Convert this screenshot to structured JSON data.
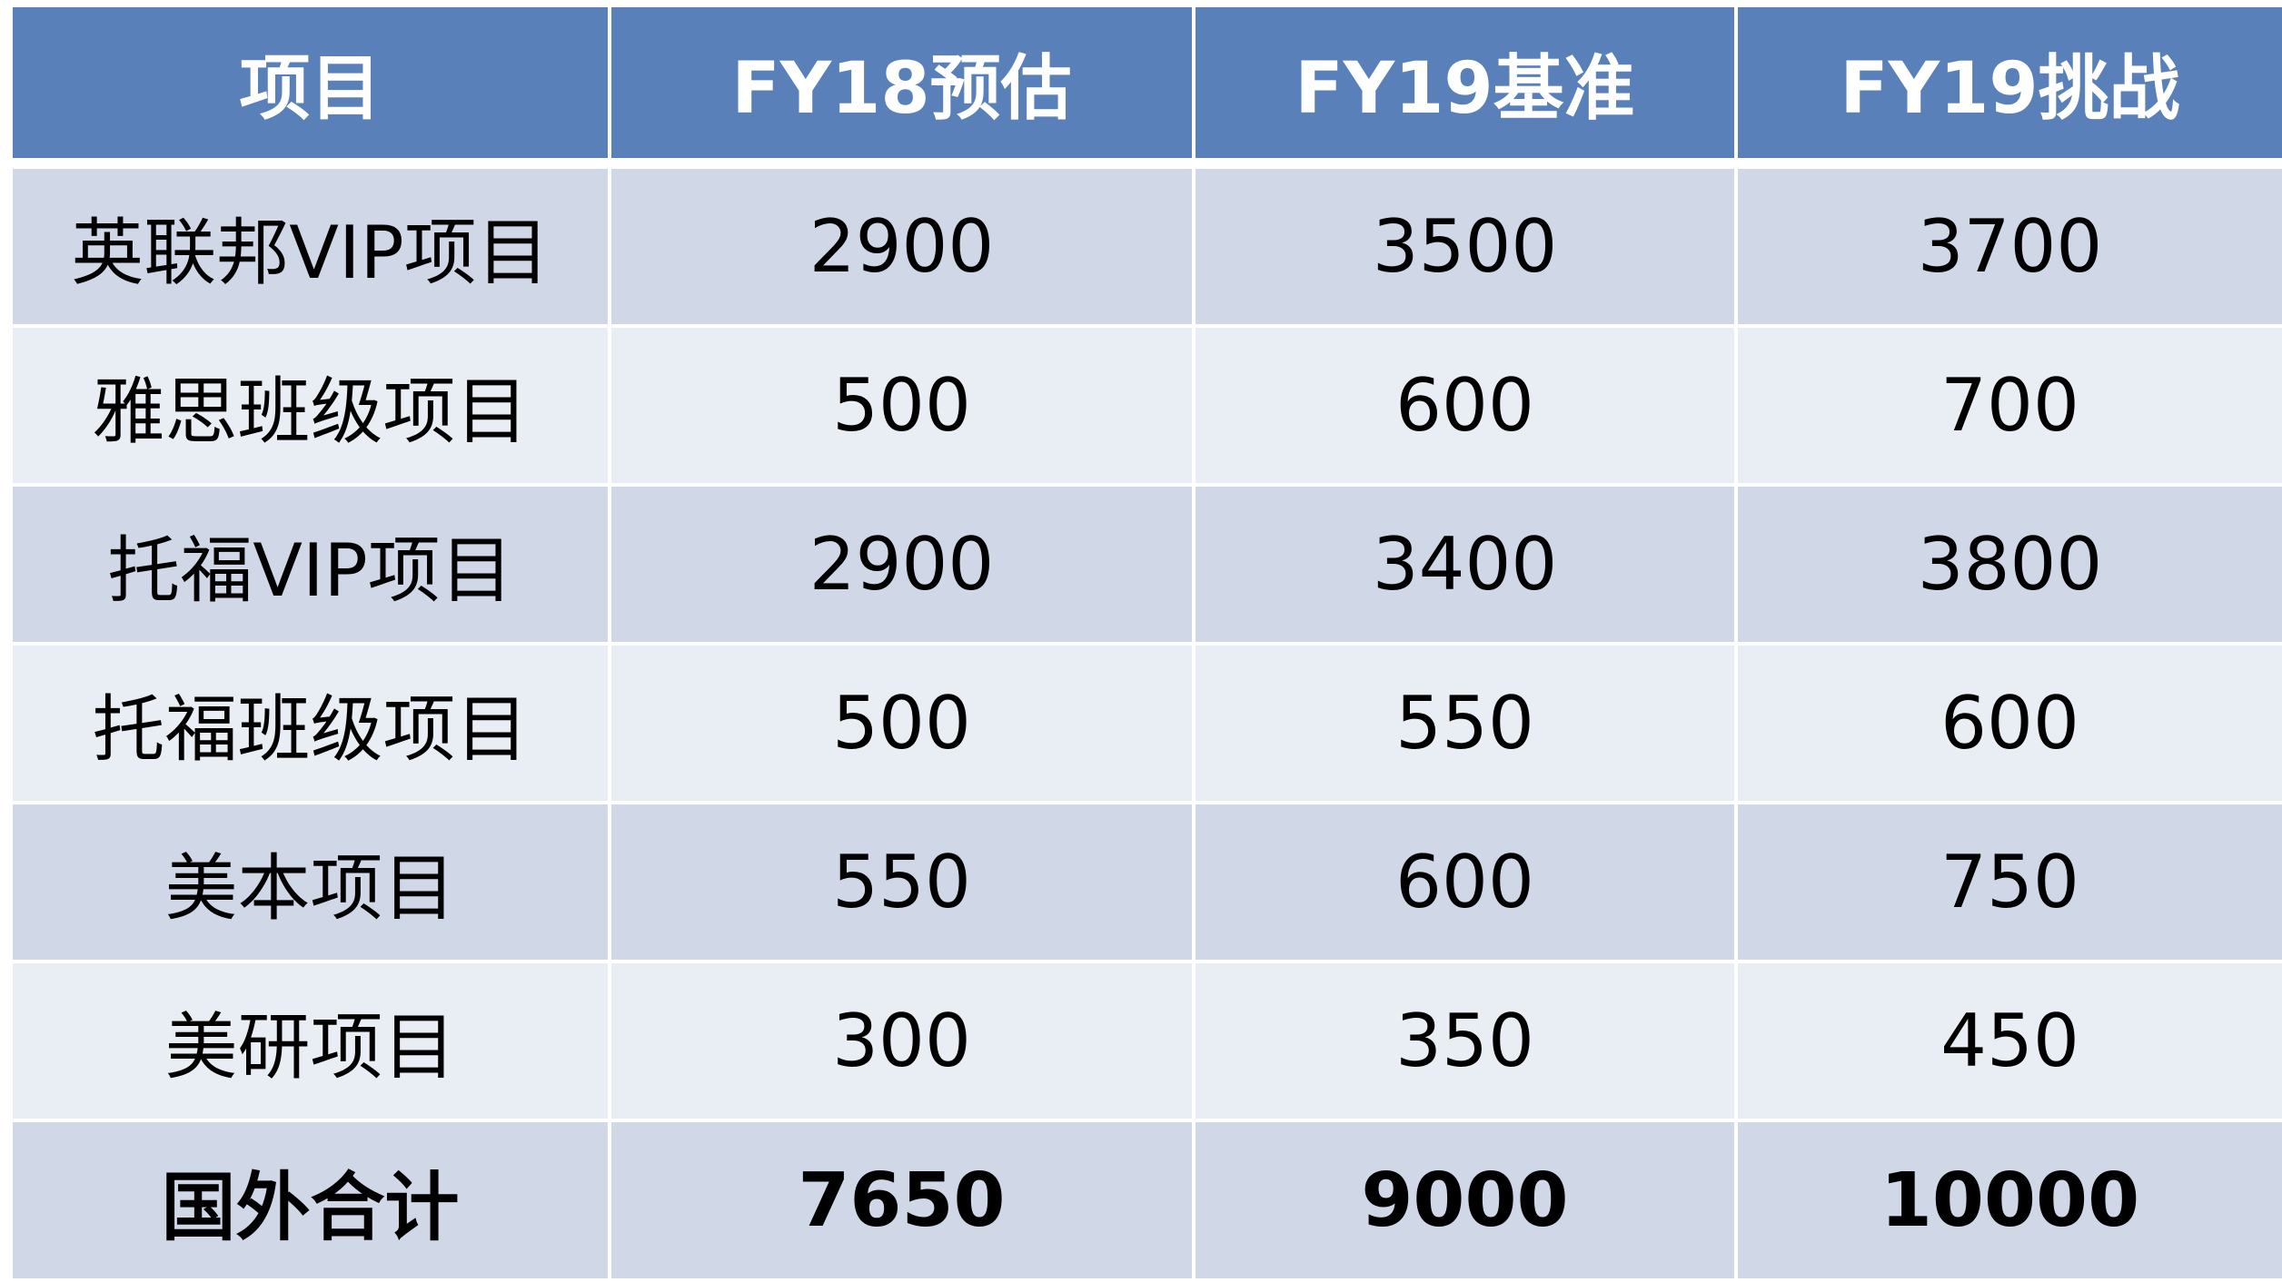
{
  "chart_data": {
    "type": "table",
    "columns": [
      "项目",
      "FY18预估",
      "FY19基准",
      "FY19挑战"
    ],
    "rows": [
      [
        "英联邦VIP项目",
        "2900",
        "3500",
        "3700"
      ],
      [
        "雅思班级项目",
        "500",
        "600",
        "700"
      ],
      [
        "托福VIP项目",
        "2900",
        "3400",
        "3800"
      ],
      [
        "托福班级项目",
        "500",
        "550",
        "600"
      ],
      [
        "美本项目",
        "550",
        "600",
        "750"
      ],
      [
        "美研项目",
        "300",
        "350",
        "450"
      ]
    ],
    "total": [
      "国外合计",
      "7650",
      "9000",
      "10000"
    ]
  },
  "colors": {
    "header_bg": "#5a80b9",
    "header_text": "#ffffff",
    "row_dark": "#d0d8e8",
    "row_light": "#e9edf4",
    "cell_text": "#000000"
  }
}
